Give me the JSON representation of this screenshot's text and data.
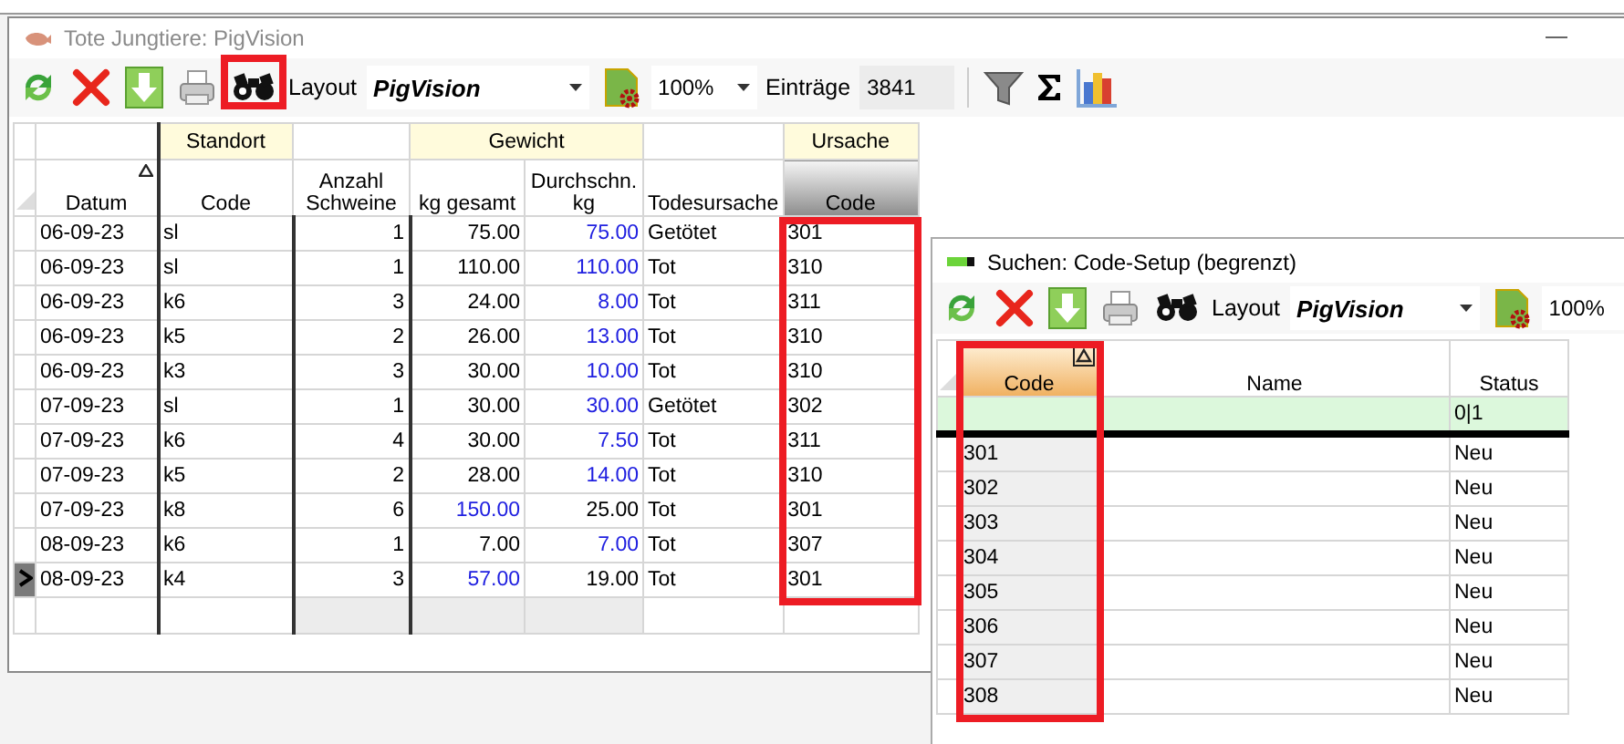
{
  "main_window": {
    "title": "Tote Jungtiere: PigVision",
    "toolbar": {
      "search_highlighted": true,
      "layout_label": "Layout",
      "layout_value": "PigVision",
      "zoom": "100%",
      "entries_label": "Einträge",
      "entries_value": "3841"
    },
    "table": {
      "column_groups": [
        {
          "columns": [
            {
              "label": "Datum",
              "kind": "text",
              "sorted": true,
              "selected": false,
              "highlighted": false
            }
          ]
        },
        {
          "label": "Standort",
          "columns": [
            {
              "label": "Code",
              "kind": "text",
              "sorted": false,
              "selected": false,
              "highlighted": false
            }
          ]
        },
        {
          "columns": [
            {
              "label": "Anzahl Schweine",
              "kind": "number",
              "sorted": false,
              "selected": false,
              "highlighted": false
            }
          ]
        },
        {
          "label": "Gewicht",
          "columns": [
            {
              "label": "kg gesamt",
              "kind": "number",
              "sorted": false,
              "selected": false,
              "highlighted": false
            },
            {
              "label": "Durchschn. kg",
              "kind": "number",
              "sorted": false,
              "selected": false,
              "highlighted": false
            }
          ]
        },
        {
          "columns": [
            {
              "label": "Todesursache",
              "kind": "text",
              "sorted": false,
              "selected": false,
              "highlighted": false
            }
          ]
        },
        {
          "label": "Ursache",
          "columns": [
            {
              "label": "Code",
              "kind": "text",
              "sorted": false,
              "selected": true,
              "highlighted": true
            }
          ]
        }
      ],
      "rows": [
        {
          "cells": [
            "06-09-23",
            "sl",
            "1",
            "75.00",
            "75.00",
            "Getötet",
            "301"
          ],
          "kg_total_flagged": false,
          "avg_flagged": true,
          "current": false
        },
        {
          "cells": [
            "06-09-23",
            "sl",
            "1",
            "110.00",
            "110.00",
            "Tot",
            "310"
          ],
          "kg_total_flagged": false,
          "avg_flagged": true,
          "current": false
        },
        {
          "cells": [
            "06-09-23",
            "k6",
            "3",
            "24.00",
            "8.00",
            "Tot",
            "311"
          ],
          "kg_total_flagged": false,
          "avg_flagged": true,
          "current": false
        },
        {
          "cells": [
            "06-09-23",
            "k5",
            "2",
            "26.00",
            "13.00",
            "Tot",
            "310"
          ],
          "kg_total_flagged": false,
          "avg_flagged": true,
          "current": false
        },
        {
          "cells": [
            "06-09-23",
            "k3",
            "3",
            "30.00",
            "10.00",
            "Tot",
            "310"
          ],
          "kg_total_flagged": false,
          "avg_flagged": true,
          "current": false
        },
        {
          "cells": [
            "07-09-23",
            "sl",
            "1",
            "30.00",
            "30.00",
            "Getötet",
            "302"
          ],
          "kg_total_flagged": false,
          "avg_flagged": true,
          "current": false
        },
        {
          "cells": [
            "07-09-23",
            "k6",
            "4",
            "30.00",
            "7.50",
            "Tot",
            "311"
          ],
          "kg_total_flagged": false,
          "avg_flagged": true,
          "current": false
        },
        {
          "cells": [
            "07-09-23",
            "k5",
            "2",
            "28.00",
            "14.00",
            "Tot",
            "310"
          ],
          "kg_total_flagged": false,
          "avg_flagged": true,
          "current": false
        },
        {
          "cells": [
            "07-09-23",
            "k8",
            "6",
            "150.00",
            "25.00",
            "Tot",
            "301"
          ],
          "kg_total_flagged": true,
          "avg_flagged": false,
          "current": false
        },
        {
          "cells": [
            "08-09-23",
            "k6",
            "1",
            "7.00",
            "7.00",
            "Tot",
            "307"
          ],
          "kg_total_flagged": false,
          "avg_flagged": true,
          "current": false
        },
        {
          "cells": [
            "08-09-23",
            "k4",
            "3",
            "57.00",
            "19.00",
            "Tot",
            "301"
          ],
          "kg_total_flagged": true,
          "avg_flagged": false,
          "current": true
        }
      ]
    }
  },
  "search_window": {
    "title": "Suchen: Code-Setup (begrenzt)",
    "toolbar": {
      "layout_label": "Layout",
      "layout_value": "PigVision",
      "zoom": "100%"
    },
    "table": {
      "columns": [
        {
          "label": "Code",
          "sorted": true,
          "selected": true,
          "highlighted": true
        },
        {
          "label": "Name",
          "sorted": false,
          "selected": false,
          "highlighted": false
        },
        {
          "label": "Status",
          "sorted": false,
          "selected": false,
          "highlighted": false,
          "filter": "0|1"
        }
      ],
      "rows": [
        {
          "code": "301",
          "status": "Neu"
        },
        {
          "code": "302",
          "status": "Neu"
        },
        {
          "code": "303",
          "status": "Neu"
        },
        {
          "code": "304",
          "status": "Neu"
        },
        {
          "code": "305",
          "status": "Neu"
        },
        {
          "code": "306",
          "status": "Neu"
        },
        {
          "code": "307",
          "status": "Neu"
        },
        {
          "code": "308",
          "status": "Neu"
        }
      ]
    }
  }
}
